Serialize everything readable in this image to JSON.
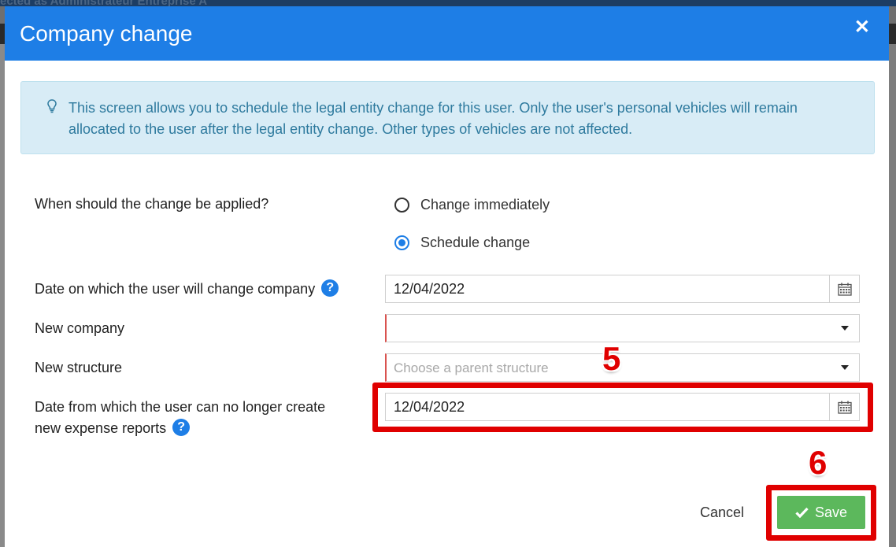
{
  "background": {
    "topbar_text": "ected as Administrateur Entreprise A"
  },
  "modal": {
    "title": "Company change",
    "close_icon": "close-icon",
    "info": {
      "icon": "lightbulb-icon",
      "text": "This screen allows you to schedule the legal entity change for this user. Only the user's personal vehicles will remain allocated to the user after the legal entity change. Other types of vehicles are not affected."
    },
    "form": {
      "when_label": "When should the change be applied?",
      "options": [
        {
          "label": "Change immediately",
          "checked": false
        },
        {
          "label": "Schedule change",
          "checked": true
        }
      ],
      "change_date_label": "Date on which the user will change company",
      "change_date_value": "12/04/2022",
      "new_company_label": "New company",
      "new_company_value": "",
      "new_structure_label": "New structure",
      "new_structure_placeholder": "Choose a parent structure",
      "expense_date_label_line1": "Date from which the user can no longer create",
      "expense_date_label_line2": "new expense reports",
      "expense_date_value": "12/04/2022"
    },
    "footer": {
      "cancel_label": "Cancel",
      "save_label": "Save"
    }
  },
  "annotations": {
    "step5": "5",
    "step6": "6",
    "color": "#e00000"
  },
  "colors": {
    "header": "#1e7ee6",
    "save": "#5cb85c",
    "info_bg": "#d8ecf6",
    "info_text": "#2e7a9e"
  }
}
